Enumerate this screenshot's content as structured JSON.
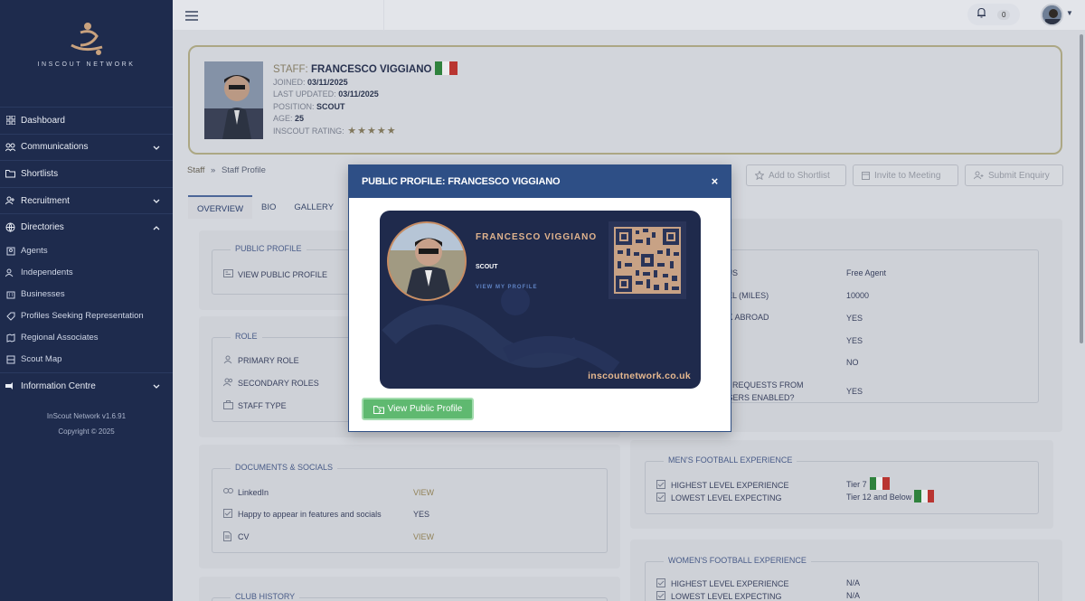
{
  "app": {
    "brand": "INSCOUT NETWORK",
    "version": "InScout Network v1.6.91",
    "copyright": "Copyright © 2025"
  },
  "sidebar": {
    "items": [
      {
        "label": "Dashboard",
        "icon": "dashboard-icon"
      },
      {
        "label": "Communications",
        "icon": "communications-icon"
      },
      {
        "label": "Shortlists",
        "icon": "folder-icon"
      },
      {
        "label": "Recruitment",
        "icon": "recruitment-icon"
      },
      {
        "label": "Directories",
        "icon": "globe-icon"
      }
    ],
    "sub_items": [
      {
        "label": "Agents",
        "icon": "agent-icon"
      },
      {
        "label": "Independents",
        "icon": "users-icon"
      },
      {
        "label": "Businesses",
        "icon": "building-icon"
      },
      {
        "label": "Profiles Seeking Representation",
        "icon": "tag-icon"
      },
      {
        "label": "Regional Associates",
        "icon": "map-icon"
      },
      {
        "label": "Scout Map",
        "icon": "map-outline-icon"
      }
    ],
    "info": {
      "label": "Information Centre",
      "icon": "info-icon"
    }
  },
  "topbar": {
    "notification_count": "0"
  },
  "profile": {
    "staff_label": "STAFF:",
    "name": "FRANCESCO VIGGIANO",
    "joined_label": "JOINED:",
    "joined": "03/11/2025",
    "updated_label": "LAST UPDATED:",
    "updated": "03/11/2025",
    "position_label": "POSITION:",
    "position": "SCOUT",
    "age_label": "AGE:",
    "age": "25",
    "rating_label": "INSCOUT RATING:",
    "rating": 5,
    "flag_colors": [
      "#2e8a3a",
      "#ffffff",
      "#c8342d"
    ]
  },
  "breadcrumb": {
    "root": "Staff",
    "sep": "»",
    "current": "Staff Profile"
  },
  "tabs": [
    "OVERVIEW",
    "BIO",
    "GALLERY"
  ],
  "actions": {
    "shortlist": "Add to Shortlist",
    "meeting": "Invite to Meeting",
    "enquiry": "Submit Enquiry"
  },
  "sections": {
    "public_profile": {
      "title": "PUBLIC PROFILE",
      "view": "VIEW PUBLIC PROFILE"
    },
    "role": {
      "title": "ROLE",
      "rows": [
        "PRIMARY ROLE",
        "SECONDARY ROLES",
        "STAFF TYPE"
      ]
    },
    "documents": {
      "title": "DOCUMENTS & SOCIALS",
      "rows": [
        {
          "label": "LinkedIn",
          "value": "VIEW"
        },
        {
          "label": "Happy to appear in features and socials",
          "value": "YES"
        },
        {
          "label": "CV",
          "value": "VIEW"
        }
      ]
    },
    "club_history": {
      "title": "CLUB HISTORY"
    },
    "status": {
      "rows": [
        {
          "label": "TUS",
          "value": "Free Agent"
        },
        {
          "label": "VEL (MILES)",
          "value": "10000"
        },
        {
          "label": "RK ABROAD",
          "value": "YES"
        },
        {
          "label": "",
          "value": "YES"
        },
        {
          "label": "",
          "value": "NO"
        },
        {
          "label": "REQUESTS FROM",
          "label2": "USERS ENABLED?",
          "value": "YES"
        }
      ]
    },
    "mens": {
      "title": "MEN'S FOOTBALL EXPERIENCE",
      "rows": [
        {
          "label": "HIGHEST LEVEL EXPERIENCE",
          "value": "Tier 7"
        },
        {
          "label": "LOWEST LEVEL EXPECTING",
          "value": "Tier 12 and Below"
        }
      ]
    },
    "womens": {
      "title": "WOMEN'S FOOTBALL EXPERIENCE",
      "rows": [
        {
          "label": "HIGHEST LEVEL EXPERIENCE",
          "value": "N/A"
        },
        {
          "label": "LOWEST LEVEL EXPECTING",
          "value": "N/A"
        }
      ]
    }
  },
  "modal": {
    "title": "PUBLIC PROFILE: FRANCESCO VIGGIANO",
    "close": "×",
    "card": {
      "name": "FRANCESCO VIGGIANO",
      "role": "SCOUT",
      "link": "VIEW MY PROFILE",
      "site": "inscoutnetwork.co.uk"
    },
    "button": "View Public Profile"
  }
}
